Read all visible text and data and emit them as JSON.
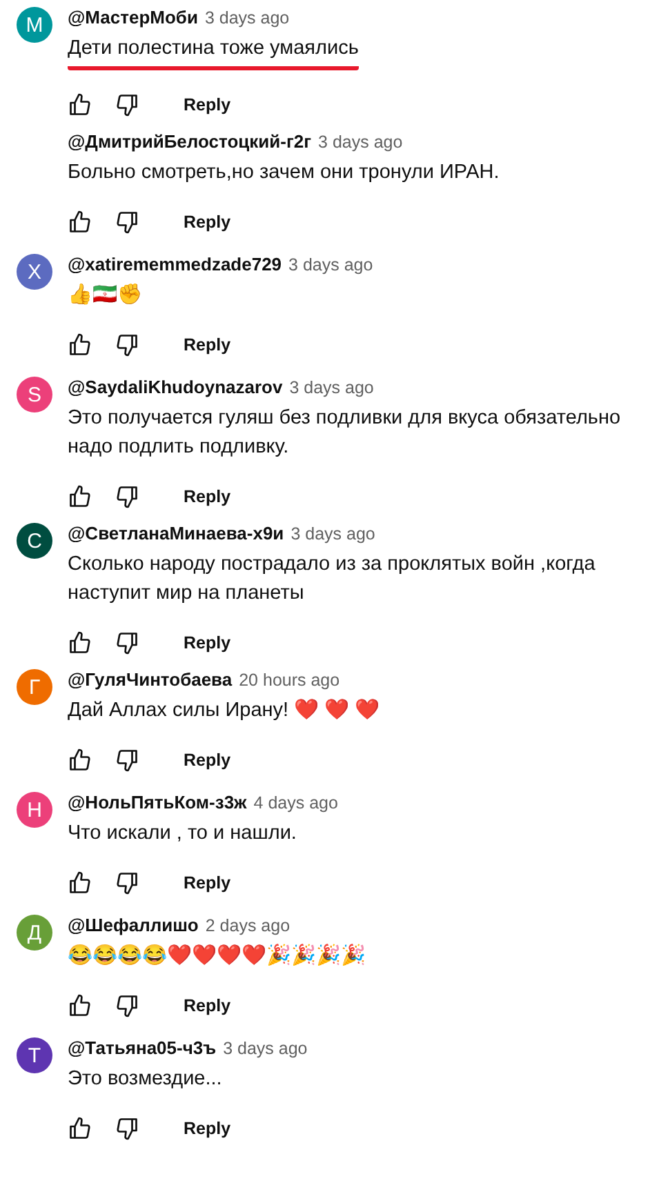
{
  "comments": [
    {
      "avatar": "М",
      "color": "#00979c",
      "author": "@МастерМоби",
      "time": "3 days ago",
      "text": "Дети полестина тоже умаялись",
      "underlined": true,
      "reply": "Reply"
    },
    {
      "author": "@ДмитрийБелостоцкий-г2г",
      "time": "3 days ago",
      "text": "Больно смотреть,но зачем они тронули   ИРАН.",
      "underlined": false,
      "reply": "Reply"
    },
    {
      "avatar": "X",
      "color": "#5c6bc0",
      "author": "@xatirememmedzade729",
      "time": "3 days ago",
      "text": "👍🇮🇷✊",
      "underlined": false,
      "reply": "Reply"
    },
    {
      "avatar": "S",
      "color": "#ec407a",
      "author": "@SaydaliKhudoynazarov",
      "time": "3 days ago",
      "text": "Это получается гуляш без подливки для вкуса обязательно надо подлить подливку.",
      "underlined": false,
      "reply": "Reply"
    },
    {
      "avatar": "С",
      "color": "#004d40",
      "author": "@СветланаМинаева-х9и",
      "time": "3 days ago",
      "text": "Сколько народу пострадало из за проклятых войн ,когда наступит мир на планеты",
      "underlined": false,
      "reply": "Reply"
    },
    {
      "avatar": "Г",
      "color": "#ef6c00",
      "author": "@ГуляЧинтобаева",
      "time": "20 hours ago",
      "text": "Дай Аллах силы Ирану! ❤️ ❤️ ❤️",
      "underlined": false,
      "reply": "Reply"
    },
    {
      "avatar": "Н",
      "color": "#ec407a",
      "author": "@НольПятьКом-з3ж",
      "time": "4 days ago",
      "text": "Что искали , то и нашли.",
      "underlined": false,
      "reply": "Reply"
    },
    {
      "avatar": "Д",
      "color": "#689f38",
      "author": "@Шефаллишо",
      "time": "2 days ago",
      "text": "😂😂😂😂❤️❤️❤️❤️🎉🎉🎉🎉",
      "underlined": false,
      "reply": "Reply"
    },
    {
      "avatar": "Т",
      "color": "#5e35b1",
      "author": "@Татьяна05-ч3ъ",
      "time": "3 days ago",
      "text": "Это возмездие...",
      "underlined": false,
      "reply": "Reply"
    }
  ]
}
